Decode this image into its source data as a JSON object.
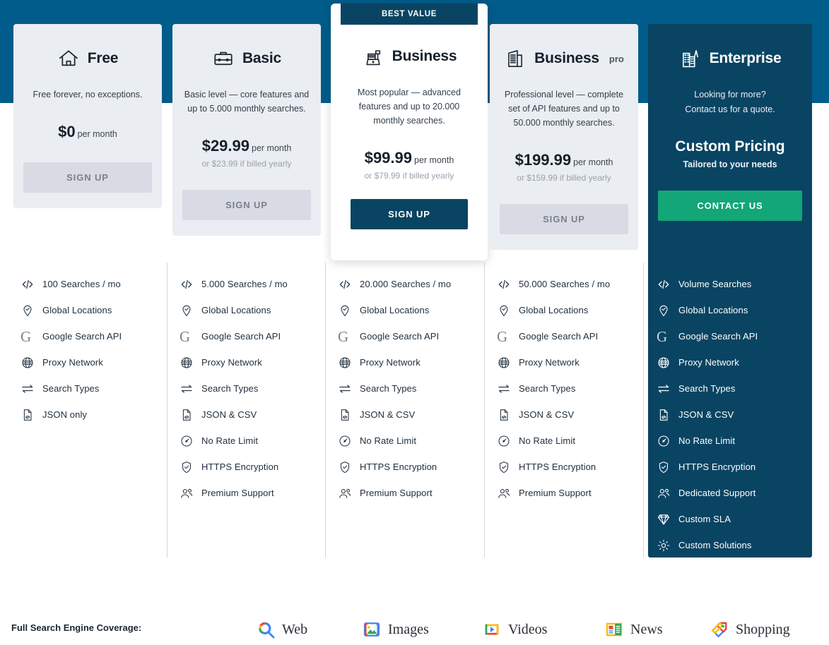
{
  "theme": {
    "band_blue": "#005C8A",
    "navy": "#0A4463",
    "card_gray": "#EAEDF1",
    "green": "#12A678",
    "divider": "#D3D6E2"
  },
  "badge": {
    "best_value": "BEST VALUE"
  },
  "plans": [
    {
      "id": "free",
      "name": "Free",
      "sup": "",
      "icon": "home-icon",
      "description": "Free forever, no exceptions.",
      "price": "$0",
      "price_period": "per month",
      "price_yearly": "",
      "cta": "SIGN UP",
      "features": [
        {
          "icon": "code-icon",
          "label": "100 Searches / mo"
        },
        {
          "icon": "location-pin-icon",
          "label": "Global Locations"
        },
        {
          "icon": "google-g-icon",
          "label": "Google Search API"
        },
        {
          "icon": "globe-icon",
          "label": "Proxy Network"
        },
        {
          "icon": "exchange-arrows-icon",
          "label": "Search Types"
        },
        {
          "icon": "file-code-icon",
          "label": "JSON only"
        }
      ]
    },
    {
      "id": "basic",
      "name": "Basic",
      "sup": "",
      "icon": "briefcase-icon",
      "description": "Basic level — core features and up to 5.000 monthly searches.",
      "price": "$29.99",
      "price_period": "per month",
      "price_yearly": "or $23.99 if billed yearly",
      "cta": "SIGN UP",
      "features": [
        {
          "icon": "code-icon",
          "label": "5.000 Searches / mo"
        },
        {
          "icon": "location-pin-icon",
          "label": "Global Locations"
        },
        {
          "icon": "google-g-icon",
          "label": "Google Search API"
        },
        {
          "icon": "globe-icon",
          "label": "Proxy Network"
        },
        {
          "icon": "exchange-arrows-icon",
          "label": "Search Types"
        },
        {
          "icon": "file-code-icon",
          "label": "JSON & CSV"
        },
        {
          "icon": "gauge-icon",
          "label": "No Rate Limit"
        },
        {
          "icon": "shield-check-icon",
          "label": "HTTPS Encryption"
        },
        {
          "icon": "people-icon",
          "label": "Premium Support"
        }
      ]
    },
    {
      "id": "business",
      "name": "Business",
      "sup": "",
      "icon": "cash-register-icon",
      "description": "Most popular — advanced features and up to 20.000 monthly searches.",
      "price": "$99.99",
      "price_period": "per month",
      "price_yearly": "or $79.99 if billed yearly",
      "cta": "SIGN UP",
      "features": [
        {
          "icon": "code-icon",
          "label": "20.000 Searches / mo"
        },
        {
          "icon": "location-pin-icon",
          "label": "Global Locations"
        },
        {
          "icon": "google-g-icon",
          "label": "Google Search API"
        },
        {
          "icon": "globe-icon",
          "label": "Proxy Network"
        },
        {
          "icon": "exchange-arrows-icon",
          "label": "Search Types"
        },
        {
          "icon": "file-code-icon",
          "label": "JSON & CSV"
        },
        {
          "icon": "gauge-icon",
          "label": "No Rate Limit"
        },
        {
          "icon": "shield-check-icon",
          "label": "HTTPS Encryption"
        },
        {
          "icon": "people-icon",
          "label": "Premium Support"
        }
      ]
    },
    {
      "id": "business-pro",
      "name": "Business",
      "sup": "pro",
      "icon": "office-building-icon",
      "description": "Professional level — complete set of API features and up to 50.000 monthly searches.",
      "price": "$199.99",
      "price_period": "per month",
      "price_yearly": "or $159.99 if billed yearly",
      "cta": "SIGN UP",
      "features": [
        {
          "icon": "code-icon",
          "label": "50.000 Searches / mo"
        },
        {
          "icon": "location-pin-icon",
          "label": "Global Locations"
        },
        {
          "icon": "google-g-icon",
          "label": "Google Search API"
        },
        {
          "icon": "globe-icon",
          "label": "Proxy Network"
        },
        {
          "icon": "exchange-arrows-icon",
          "label": "Search Types"
        },
        {
          "icon": "file-code-icon",
          "label": "JSON & CSV"
        },
        {
          "icon": "gauge-icon",
          "label": "No Rate Limit"
        },
        {
          "icon": "shield-check-icon",
          "label": "HTTPS Encryption"
        },
        {
          "icon": "people-icon",
          "label": "Premium Support"
        }
      ]
    },
    {
      "id": "enterprise",
      "name": "Enterprise",
      "sup": "",
      "icon": "city-buildings-icon",
      "description": "Looking for more?\nContact us for a quote.",
      "price": "Custom Pricing",
      "price_period": "Tailored to your needs",
      "price_yearly": "",
      "cta": "CONTACT US",
      "features": [
        {
          "icon": "code-icon",
          "label": "Volume Searches"
        },
        {
          "icon": "location-pin-icon",
          "label": "Global Locations"
        },
        {
          "icon": "google-g-icon",
          "label": "Google Search API"
        },
        {
          "icon": "globe-icon",
          "label": "Proxy Network"
        },
        {
          "icon": "exchange-arrows-icon",
          "label": "Search Types"
        },
        {
          "icon": "file-code-icon",
          "label": "JSON & CSV"
        },
        {
          "icon": "gauge-icon",
          "label": "No Rate Limit"
        },
        {
          "icon": "shield-check-icon",
          "label": "HTTPS Encryption"
        },
        {
          "icon": "people-icon",
          "label": "Dedicated Support"
        },
        {
          "icon": "diamond-icon",
          "label": "Custom SLA"
        },
        {
          "icon": "gear-icon",
          "label": "Custom Solutions"
        }
      ]
    }
  ],
  "footer": {
    "label": "Full Search Engine Coverage:",
    "engines": [
      {
        "icon": "google-web-search-icon",
        "label": "Web"
      },
      {
        "icon": "google-images-icon",
        "label": "Images"
      },
      {
        "icon": "google-videos-icon",
        "label": "Videos"
      },
      {
        "icon": "google-news-icon",
        "label": "News"
      },
      {
        "icon": "google-shopping-icon",
        "label": "Shopping"
      }
    ]
  }
}
